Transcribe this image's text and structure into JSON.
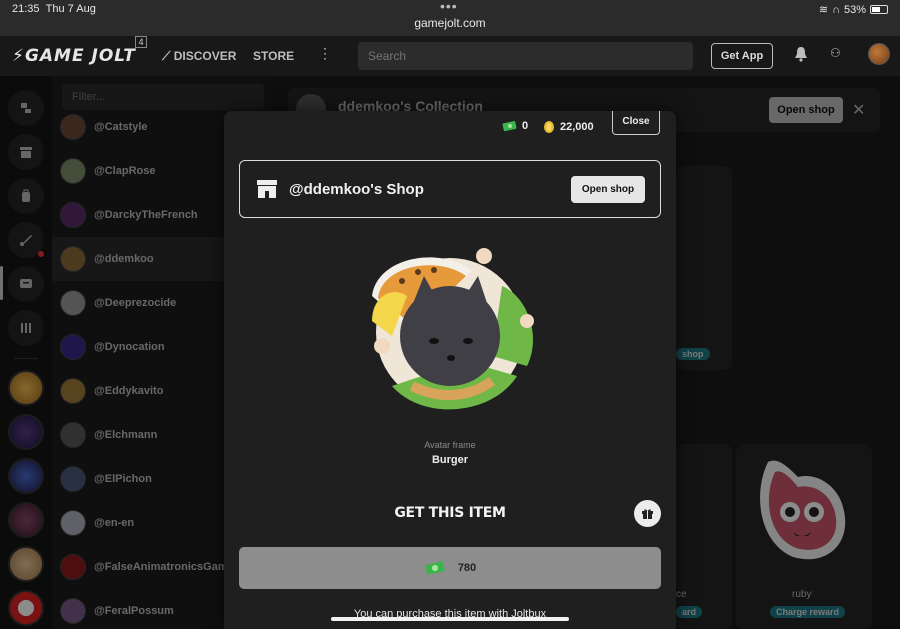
{
  "status_bar": {
    "time": "21:35",
    "date": "Thu 7 Aug",
    "url": "gamejolt.com",
    "battery": "53%"
  },
  "topnav": {
    "logo": "GAME JOLT",
    "logo_badge": "4",
    "discover": "DISCOVER",
    "store": "STORE",
    "search_placeholder": "Search",
    "get_app": "Get App"
  },
  "list": {
    "filter_placeholder": "Filter...",
    "items": [
      {
        "name": "@Catstyle",
        "color": "#6a4a3a"
      },
      {
        "name": "@ClapRose",
        "color": "#7c8a6a"
      },
      {
        "name": "@DarckyTheFrench",
        "color": "#5a2a6a"
      },
      {
        "name": "@ddemkoo",
        "color": "#8a6a3a"
      },
      {
        "name": "@Deeprezocide",
        "color": "#9a9a9a"
      },
      {
        "name": "@Dynocation",
        "color": "#3a2a8a"
      },
      {
        "name": "@Eddykavito",
        "color": "#a07a3a"
      },
      {
        "name": "@Elchmann",
        "color": "#5a5a5a"
      },
      {
        "name": "@ElPichon",
        "color": "#4a5a7a"
      },
      {
        "name": "@en-en",
        "color": "#b0b0c0"
      },
      {
        "name": "@FalseAnimatronicsGam",
        "color": "#8a1a1a"
      },
      {
        "name": "@FeralPossum",
        "color": "#7a5a8a"
      }
    ]
  },
  "background": {
    "collection_title": "ddemkoo's Collection",
    "open_shop": "Open shop",
    "shop_pill": "shop",
    "card_ruby": "ruby",
    "charge_reward": "Charge reward",
    "reward_pill": "ard",
    "partial_label": "ce"
  },
  "modal": {
    "joltbux": "0",
    "coins": "22,000",
    "close": "Close",
    "shop_title": "@ddemkoo's Shop",
    "open_shop": "Open shop",
    "item_type": "Avatar frame",
    "item_name": "Burger",
    "get_title": "GET THIS ITEM",
    "price": "780",
    "purchase_note": "You can purchase this item with Joltbux"
  },
  "colors": {
    "joltbux_green": "#3bb54a",
    "coin_gold": "#e9b92c",
    "buy_bar": "#8d8d8d"
  }
}
